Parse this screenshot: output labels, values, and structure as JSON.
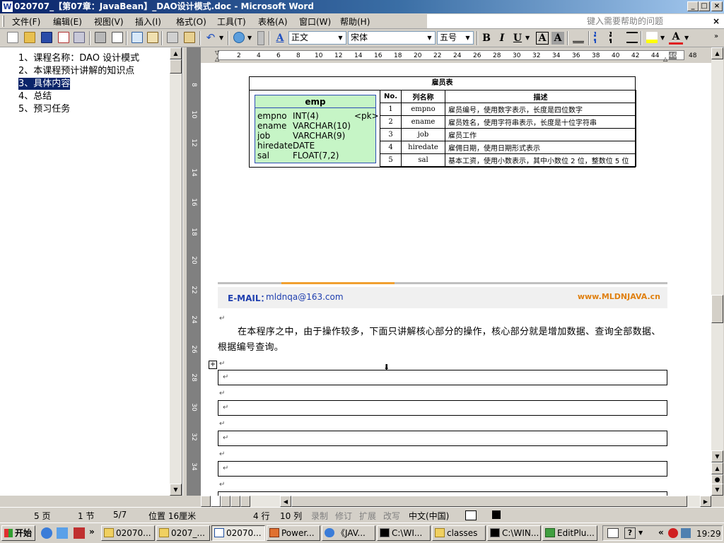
{
  "window": {
    "title": "020707_【第07章：JavaBean】_DAO设计模式.doc - Microsoft Word",
    "icon": "W",
    "controls": {
      "minimize": "_",
      "maximize": "□",
      "close": "×"
    }
  },
  "menu": {
    "items": [
      "文件(F)",
      "编辑(E)",
      "视图(V)",
      "插入(I)",
      "格式(O)",
      "工具(T)",
      "表格(A)",
      "窗口(W)",
      "帮助(H)"
    ],
    "help_placeholder": "键入需要帮助的问题",
    "close_doc": "×"
  },
  "toolbar": {
    "style": "正文",
    "font": "宋体",
    "size": "五号",
    "bold": "B",
    "italic": "I",
    "underline": "U",
    "char_border": "A",
    "char_shade": "A",
    "font_color": "A",
    "style_icon": "A"
  },
  "document_map": {
    "items": [
      {
        "label": "1、课程名称：DAO 设计模式",
        "selected": false
      },
      {
        "label": "2、本课程预计讲解的知识点",
        "selected": false
      },
      {
        "label": "3、具体内容",
        "selected": true
      },
      {
        "label": "4、总结",
        "selected": false
      },
      {
        "label": "5、预习任务",
        "selected": false
      }
    ]
  },
  "ruler": {
    "h_ticks": [
      "2",
      "4",
      "6",
      "8",
      "10",
      "12",
      "14",
      "16",
      "18",
      "20",
      "22",
      "24",
      "26",
      "28",
      "30",
      "32",
      "34",
      "36",
      "38",
      "40",
      "42",
      "44",
      "46",
      "48"
    ],
    "v_ticks": [
      "8",
      "10",
      "12",
      "14",
      "16",
      "18",
      "20",
      "22",
      "24",
      "26",
      "28",
      "30",
      "32",
      "34"
    ],
    "tab_marker": "L"
  },
  "document": {
    "emp_entity": {
      "name": "emp",
      "pk_label": "<pk>",
      "columns": [
        {
          "name": "empno",
          "type": "INT(4)"
        },
        {
          "name": "ename",
          "type": "VARCHAR(10)"
        },
        {
          "name": "job",
          "type": "VARCHAR(9)"
        },
        {
          "name": "hiredate",
          "type": "DATE"
        },
        {
          "name": "sal",
          "type": "FLOAT(7,2)"
        }
      ]
    },
    "table": {
      "caption": "雇员表",
      "headers": [
        "No.",
        "列名称",
        "描述"
      ],
      "rows": [
        [
          "1",
          "empno",
          "雇员编号，使用数字表示，长度是四位数字"
        ],
        [
          "2",
          "ename",
          "雇员姓名，使用字符串表示，长度是十位字符串"
        ],
        [
          "3",
          "job",
          "雇员工作"
        ],
        [
          "4",
          "hiredate",
          "雇佣日期，使用日期形式表示"
        ],
        [
          "5",
          "sal",
          "基本工资，使用小数表示，其中小数位 2 位，整数位 5 位"
        ]
      ]
    },
    "footer": {
      "email_label": "E-MAIL：",
      "email": "mldnqa@163.com",
      "site": "www.MLDNJAVA.cn"
    },
    "paragraph": "在本程序之中，由于操作较多，下面只讲解核心部分的操作，核心部分就是增加数据、查询全部数据、根据编号查询。",
    "para_mark": "↵",
    "empty_table_rows": 5
  },
  "status": {
    "page": "5 页",
    "section": "1 节",
    "page_of": "5/7",
    "position": "位置 16厘米",
    "line": "4 行",
    "column": "10 列",
    "rec": "录制",
    "trk": "修订",
    "ext": "扩展",
    "ovr": "改写",
    "language": "中文(中国)"
  },
  "taskbar": {
    "start": "开始",
    "tasks": [
      {
        "label": "02070...",
        "icon": "folder",
        "active": false
      },
      {
        "label": "0207_...",
        "icon": "folder",
        "active": false
      },
      {
        "label": "02070...",
        "icon": "word",
        "active": true
      },
      {
        "label": "Power...",
        "icon": "ppt",
        "active": false
      },
      {
        "label": "《JAV...",
        "icon": "ie",
        "active": false
      },
      {
        "label": "C:\\WI...",
        "icon": "cmd",
        "active": false
      },
      {
        "label": "classes",
        "icon": "folder",
        "active": false
      },
      {
        "label": "C:\\WIN...",
        "icon": "cmd",
        "active": false
      },
      {
        "label": "EditPlu...",
        "icon": "editplus",
        "active": false
      }
    ],
    "more": "»",
    "tray_more": "«",
    "clock": "19:29"
  }
}
